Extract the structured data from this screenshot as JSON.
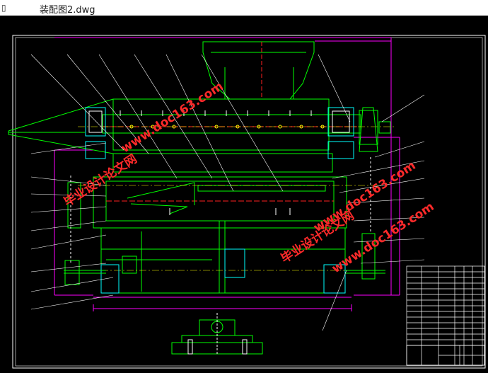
{
  "window": {
    "title": "装配图2.dwg",
    "app_icon": "document-icon"
  },
  "watermarks": [
    {
      "text": "www.doc163.com"
    },
    {
      "text": "毕业设计论文网"
    },
    {
      "text": "www.doc163.com"
    },
    {
      "text": "毕业设计论文网"
    },
    {
      "text": "www.doc163.com"
    }
  ],
  "colors": {
    "green": "#00ff00",
    "magenta": "#ff00ff",
    "white": "#ffffff",
    "cyan": "#00ffff",
    "red": "#ff2020",
    "yellow": "#ffff00",
    "watermark": "#ff2a2a",
    "background": "#000000"
  }
}
